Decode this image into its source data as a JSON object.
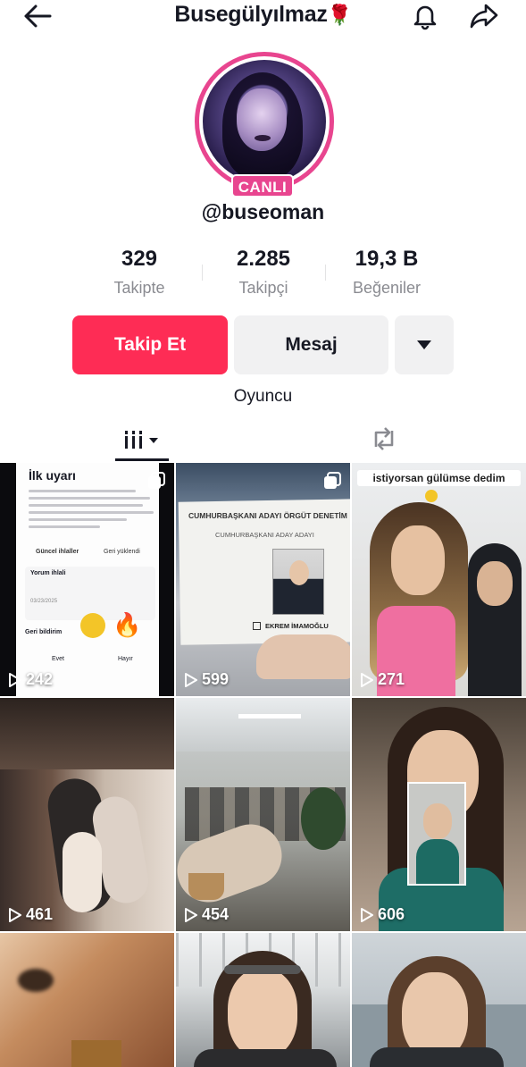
{
  "header": {
    "title": "Busegülyılmaz",
    "title_emoji": "🌹",
    "back_icon": "arrow-left-icon",
    "bell_icon": "bell-icon",
    "share_icon": "share-arrow-icon"
  },
  "profile": {
    "live_badge": "CANLI",
    "username": "@buseoman",
    "bio": "Oyuncu"
  },
  "stats": [
    {
      "value": "329",
      "label": "Takipte"
    },
    {
      "value": "2.285",
      "label": "Takipçi"
    },
    {
      "value": "19,3 B",
      "label": "Beğeniler"
    }
  ],
  "actions": {
    "follow_label": "Takip Et",
    "message_label": "Mesaj",
    "more_icon": "caret-down-icon"
  },
  "tabs": {
    "videos_icon": "grid-bars-icon",
    "reposts_icon": "repost-icon"
  },
  "colors": {
    "accent": "#fe2c55",
    "live": "#e8458f",
    "secondary_button": "#f1f1f2",
    "muted_text": "#8a8b91"
  },
  "grid": {
    "videos": [
      {
        "views": "242",
        "multi_image": true,
        "overlay": {
          "heading": "İlk uyarı",
          "tab_1": "Güncel ihlaller",
          "tab_2": "Geri yüklendi",
          "card_title": "Yorum ihlali",
          "date": "03/23/2025",
          "feedback": "Geri bildirim",
          "yes": "Evet",
          "no": "Hayır"
        }
      },
      {
        "views": "599",
        "multi_image": true,
        "overlay": {
          "header": "CUMHURBAŞKANI ADAYI ÖRGÜT DENETİM",
          "subheader": "CUMHURBAŞKANI ADAY ADAYI",
          "candidate": "EKREM İMAMOĞLU"
        }
      },
      {
        "views": "271",
        "multi_image": false,
        "overlay": {
          "caption": "istiyorsan gülümse dedim"
        }
      },
      {
        "views": "461",
        "multi_image": false
      },
      {
        "views": "454",
        "multi_image": false
      },
      {
        "views": "606",
        "multi_image": false
      },
      {
        "views": "",
        "multi_image": false
      },
      {
        "views": "",
        "multi_image": false
      },
      {
        "views": "",
        "multi_image": false
      }
    ]
  }
}
